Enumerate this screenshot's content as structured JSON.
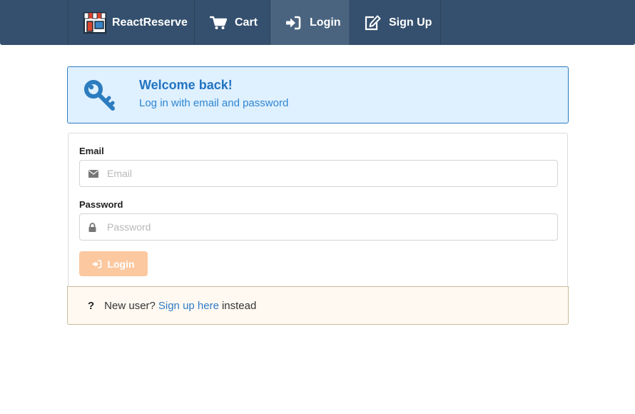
{
  "navbar": {
    "brand": "ReactReserve",
    "items": [
      {
        "label": "Cart",
        "icon": "cart-icon"
      },
      {
        "label": "Login",
        "icon": "sign-in-icon",
        "active": true
      },
      {
        "label": "Sign Up",
        "icon": "edit-icon"
      }
    ],
    "colors": {
      "background": "#35506e",
      "active": "#4a6480"
    }
  },
  "welcome": {
    "title": "Welcome back!",
    "subtitle": "Log in with email and password",
    "icon": "key-icon"
  },
  "form": {
    "email": {
      "label": "Email",
      "placeholder": "Email",
      "value": "",
      "icon": "envelope-icon"
    },
    "password": {
      "label": "Password",
      "placeholder": "Password",
      "value": "",
      "icon": "lock-icon"
    },
    "submit_label": "Login",
    "submit_color": "#fbc8a0"
  },
  "signup_note": {
    "prefix": "New user?",
    "link": "Sign up here",
    "suffix": "instead"
  }
}
